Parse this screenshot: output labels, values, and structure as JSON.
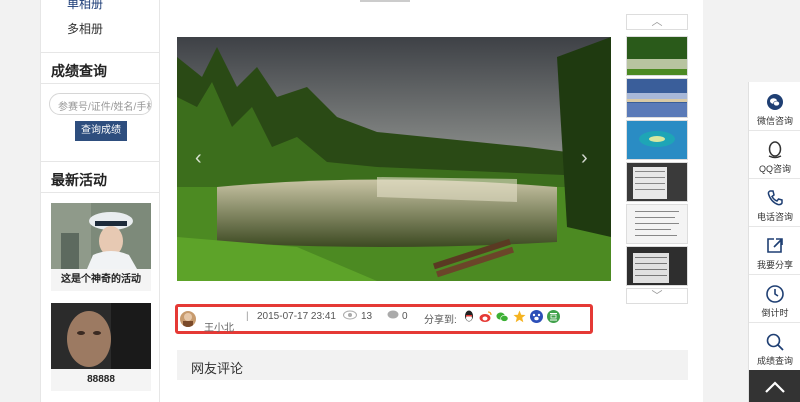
{
  "sidebar": {
    "albums": [
      "单相册",
      "多相册"
    ],
    "score_query": {
      "title": "成绩查询",
      "placeholder": "参赛号/证件/姓名/手机",
      "button": "查询成绩"
    },
    "activities": {
      "title": "最新活动",
      "items": [
        {
          "caption": "这是个神奇的活动"
        },
        {
          "caption": "88888"
        }
      ]
    }
  },
  "main": {
    "info_bar": {
      "author": "王小北",
      "date": "2015-07-17 23:41",
      "views": "13",
      "comments": "0",
      "share_label": "分享到:",
      "share_targets": [
        "qq-icon",
        "weibo-icon",
        "wechat-icon",
        "qzone-icon",
        "baidu-icon",
        "douban-icon"
      ]
    },
    "comment_section": {
      "title": "网友评论"
    }
  },
  "float_bar": {
    "items": [
      {
        "label": "微信咨询",
        "icon": "wechat-icon"
      },
      {
        "label": "QQ咨询",
        "icon": "qq-icon"
      },
      {
        "label": "电话咨询",
        "icon": "phone-icon"
      },
      {
        "label": "我要分享",
        "icon": "share-icon"
      },
      {
        "label": "倒计时",
        "icon": "clock-icon"
      },
      {
        "label": "成绩查询",
        "icon": "search-icon"
      }
    ]
  },
  "colors": {
    "accent": "#2e4e7e",
    "highlight_border": "#e53935"
  }
}
